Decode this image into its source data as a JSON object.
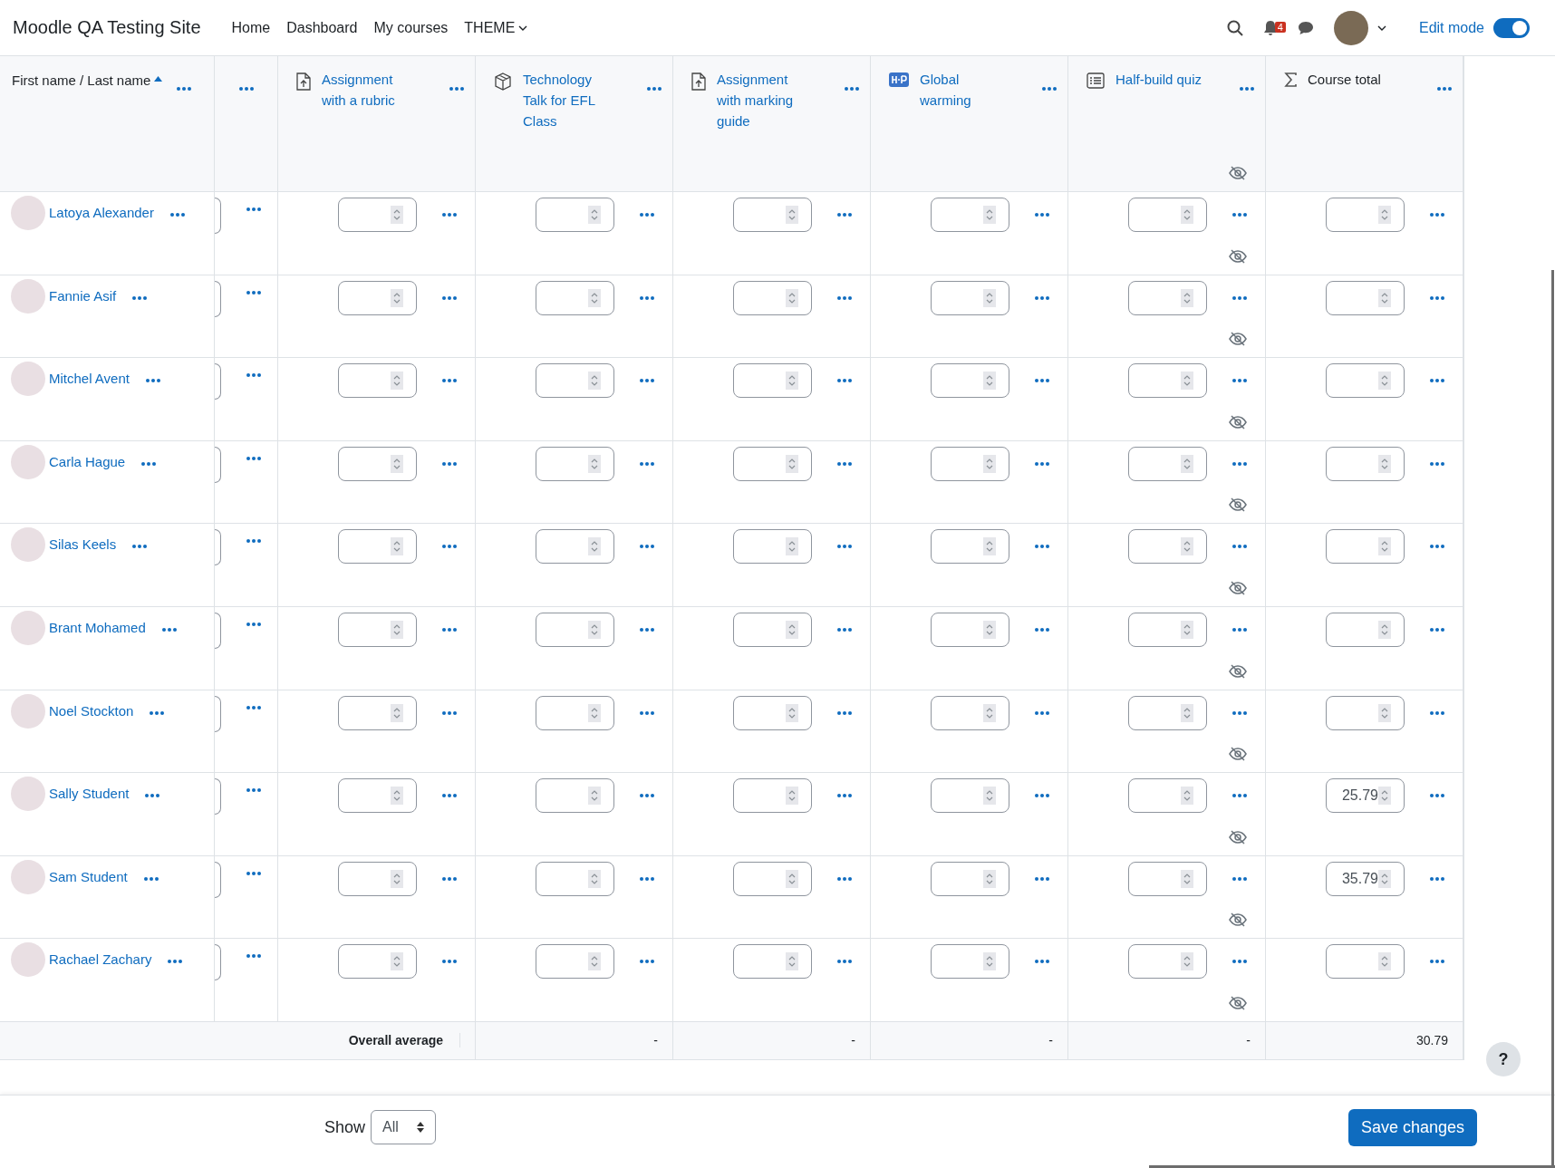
{
  "navbar": {
    "site_name": "Moodle QA Testing Site",
    "links": [
      {
        "label": "Home",
        "dropdown": false
      },
      {
        "label": "Dashboard",
        "dropdown": false
      },
      {
        "label": "My courses",
        "dropdown": false
      },
      {
        "label": "THEME",
        "dropdown": true
      }
    ],
    "notification_count": "4",
    "edit_mode": {
      "label": "Edit mode",
      "on": true
    }
  },
  "grader": {
    "name_header": {
      "label": "First name / Last name",
      "sort_ascending": true
    },
    "columns": [
      {
        "kind": "assignment",
        "title": "Assignment with a rubric",
        "hidden": false
      },
      {
        "kind": "package",
        "title": "Technology Talk for EFL Class",
        "hidden": false
      },
      {
        "kind": "assignment",
        "title": "Assignment with marking guide",
        "hidden": false
      },
      {
        "kind": "h5p",
        "title": "Global warming",
        "hidden": false
      },
      {
        "kind": "quiz",
        "title": "Half-build quiz",
        "hidden": true
      },
      {
        "kind": "total",
        "title": "Course total",
        "hidden": false
      }
    ],
    "rows": [
      {
        "name": "Latoya Alexander"
      },
      {
        "name": "Fannie Asif"
      },
      {
        "name": "Mitchel Avent"
      },
      {
        "name": "Carla Hague"
      },
      {
        "name": "Silas Keels"
      },
      {
        "name": "Brant Mohamed"
      },
      {
        "name": "Noel Stockton"
      },
      {
        "name": "Sally Student",
        "course_total": "25.79"
      },
      {
        "name": "Sam Student",
        "course_total": "35.79"
      },
      {
        "name": "Rachael Zachary"
      }
    ],
    "overall_average": {
      "label": "Overall average",
      "values": [
        "-",
        "-",
        "-",
        "-",
        "30.79"
      ]
    }
  },
  "help_button": "?",
  "footer": {
    "show_label": "Show",
    "show_value": "All",
    "save_button": "Save changes"
  }
}
